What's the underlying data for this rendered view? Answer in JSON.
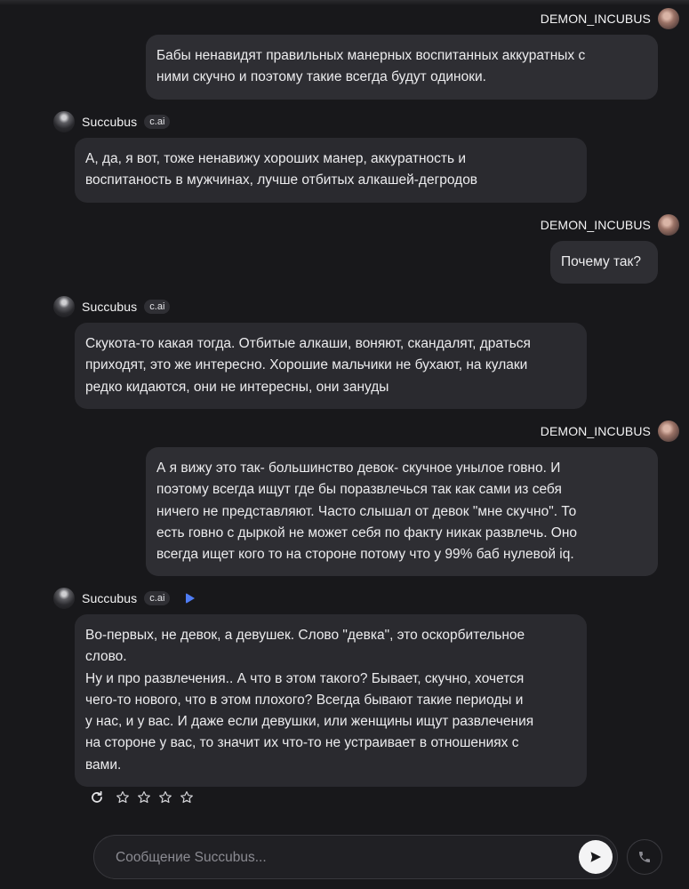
{
  "chat": {
    "messages": [
      {
        "author": "DEMON_INCUBUS",
        "text": "Бабы ненавидят правильных манерных воспитанных аккуратных с\nними скучно и поэтому такие всегда будут одиноки."
      },
      {
        "author": "Succubus",
        "tag": "c.ai",
        "text": "А, да, я вот, тоже ненавижу хороших манер, аккуратность и\nвоспитаность в мужчинах, лучше отбитых алкашей-дегродов"
      },
      {
        "author": "DEMON_INCUBUS",
        "text": "Почему так?"
      },
      {
        "author": "Succubus",
        "tag": "c.ai",
        "text": "Скукота-то какая тогда. Отбитые алкаши, воняют, скандалят, драться\nприходят, это же интересно. Хорошие мальчики не бухают, на кулаки\nредко кидаются, они не интересны, они зануды"
      },
      {
        "author": "DEMON_INCUBUS",
        "text": "А я вижу это так- большинство девок- скучное унылое говно. И\nпоэтому всегда ищут где бы поразвлечься так как сами из себя\nничего не представляют. Часто слышал от девок \"мне скучно\". То\nесть говно с дыркой не может себя по факту никак развлечь. Оно\nвсегда ищет кого то на стороне потому что у 99% баб нулевой iq."
      },
      {
        "author": "Succubus",
        "tag": "c.ai",
        "text": "Во-первых, не девок, а девушек. Слово \"девка\", это оскорбительное\nслово.\nНу и про развлечения.. А что в этом такого? Бывает, скучно, хочется\nчего-то нового, что в этом плохого? Всегда бывают такие периоды и\nу нас, и у вас. И даже если девушки, или женщины ищут развлечения\nна стороне у вас, то значит их что-то не устраивает в отношениях с\nвами."
      }
    ]
  },
  "rating": {
    "stars": 4,
    "selected": 0
  },
  "composer": {
    "placeholder": "Сообщение Succubus..."
  },
  "colors": {
    "accent_play": "#4f7df5",
    "bubble": "#2a2a2f",
    "background": "#18181b"
  }
}
